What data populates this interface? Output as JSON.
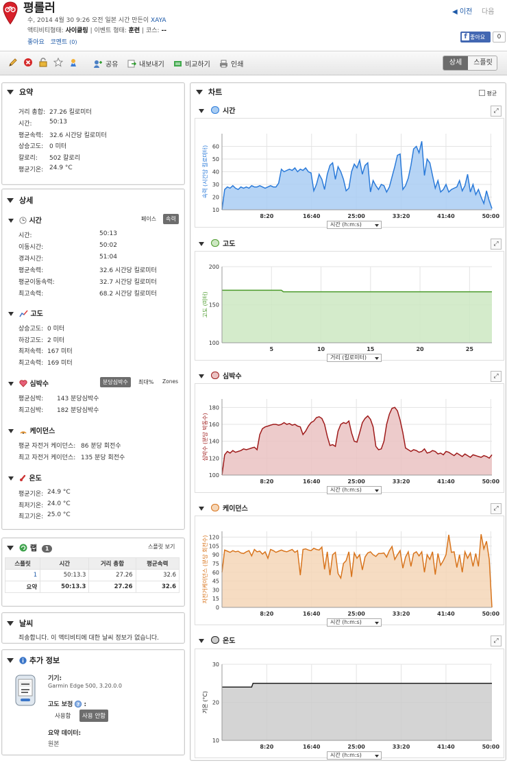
{
  "header": {
    "title": "평롤러",
    "meta_line": "수, 2014 4월 30 9:26 오전 일본 시간 만든이",
    "author": "XAYA",
    "activity_type_label": "액티비티형태:",
    "activity_type": "사이클링",
    "event_type_label": "| 이벤트 형태:",
    "event_type": "훈련",
    "course_label": "| 코스:",
    "course": "--",
    "like_link": "좋아요",
    "comment_link": "코멘트",
    "comment_count": "(0)",
    "prev": "◀ 이전",
    "next": "다음",
    "fb_like": "좋아요",
    "fb_count": "0"
  },
  "toolbar": {
    "share": "공유",
    "export": "내보내기",
    "compare": "비교하기",
    "print": "인쇄",
    "view_detail": "상세",
    "view_split": "스플릿"
  },
  "summary": {
    "title": "요약",
    "rows": [
      {
        "k": "거리 총합:",
        "v": "27.26 킬로미터"
      },
      {
        "k": "시간:",
        "v": "50:13"
      },
      {
        "k": "평균속력:",
        "v": "32.6 시간당 킬로미터"
      },
      {
        "k": "상승고도:",
        "v": "0 미터"
      },
      {
        "k": "칼로리:",
        "v": "502 칼로리"
      },
      {
        "k": "평균기온:",
        "v": "24.9 °C"
      }
    ]
  },
  "details": {
    "title": "상세",
    "time": {
      "title": "시간",
      "tab_pace": "페이스",
      "tab_speed": "속력",
      "rows": [
        {
          "k": "시간:",
          "v": "50:13"
        },
        {
          "k": "이동시간:",
          "v": "50:02"
        },
        {
          "k": "경과시간:",
          "v": "51:04"
        },
        {
          "k": "평균속력:",
          "v": "32.6 시간당 킬로미터"
        },
        {
          "k": "평균이동속력:",
          "v": "32.7 시간당 킬로미터"
        },
        {
          "k": "최고속력:",
          "v": "68.2 시간당 킬로미터"
        }
      ]
    },
    "elevation": {
      "title": "고도",
      "rows": [
        {
          "k": "상승고도:",
          "v": "0 미터"
        },
        {
          "k": "하강고도:",
          "v": "2 미터"
        },
        {
          "k": "최저속력:",
          "v": "167 미터"
        },
        {
          "k": "최고속력:",
          "v": "169 미터"
        }
      ]
    },
    "heart": {
      "title": "심박수",
      "tab_bpm": "분당심박수",
      "tab_max": "최대%",
      "tab_zones": "Zones",
      "rows": [
        {
          "k": "평균심박:",
          "v": "143 분당심박수"
        },
        {
          "k": "최고심박:",
          "v": "182 분당심박수"
        }
      ]
    },
    "cadence": {
      "title": "케이던스",
      "rows": [
        {
          "k": "평균 자전거 케이던스:",
          "v": "86 분당 회전수"
        },
        {
          "k": "최고 자전거 케이던스:",
          "v": "135 분당 회전수"
        }
      ]
    },
    "temp": {
      "title": "온도",
      "rows": [
        {
          "k": "평균기온:",
          "v": "24.9 °C"
        },
        {
          "k": "최저기온:",
          "v": "24.0 °C"
        },
        {
          "k": "최고기온:",
          "v": "25.0 °C"
        }
      ]
    }
  },
  "laps": {
    "title": "랩",
    "count": "1",
    "split_view": "스플릿 보기",
    "headers": [
      "스플릿",
      "시간",
      "거리 총합",
      "평균속력"
    ],
    "row": [
      "1",
      "50:13.3",
      "27.26",
      "32.6"
    ],
    "summary": [
      "요약",
      "50:13.3",
      "27.26",
      "32.6"
    ]
  },
  "weather": {
    "title": "날씨",
    "text": "죄송합니다. 이 액티비티에 대한 날씨 정보가 없습니다."
  },
  "extra": {
    "title": "추가 정보",
    "device_label": "기기:",
    "device": "Garmin Edge 500, 3.20.0.0",
    "elev_corr_label": "고도 보정",
    "elev_corr_suffix": ":",
    "use": "사용함",
    "not_use": "사용 안함",
    "summary_data_label": "요약 데이터:",
    "summary_data": "원본"
  },
  "charts_panel": {
    "title": "차트",
    "average_label": "평균",
    "expand_icon": "expand-icon",
    "time_axis_select": "시간 (h:m:s)",
    "dist_axis_select": "거리 (킬로미터)"
  },
  "colors": {
    "speed": "#2a7ad9",
    "elevation": "#4a9a2a",
    "heart": "#9e1a1a",
    "cadence": "#d8741c",
    "temp": "#222222"
  },
  "chart_data": [
    {
      "type": "area",
      "name_label": "시간",
      "ylabel": "속력 (시간당 킬로미터)",
      "ylim": [
        10,
        70
      ],
      "yticks": [
        "10",
        "20",
        "30",
        "40",
        "50",
        "60"
      ],
      "x_ticks": [
        "8:20",
        "16:40",
        "25:00",
        "33:20",
        "41:40",
        "50:00"
      ],
      "xlim_sec": [
        0,
        3013
      ],
      "series": [
        {
          "values": [
            10,
            26,
            28,
            27,
            29,
            27,
            26,
            28,
            27,
            28,
            27,
            29,
            28,
            28,
            29,
            28,
            27,
            28,
            29,
            28,
            28,
            31,
            42,
            40,
            41,
            42,
            41,
            43,
            40,
            42,
            41,
            43,
            40,
            39,
            25,
            30,
            38,
            34,
            26,
            38,
            45,
            47,
            34,
            44,
            40,
            34,
            25,
            27,
            40,
            46,
            43,
            49,
            38,
            45,
            47,
            24,
            33,
            29,
            26,
            30,
            29,
            24,
            28,
            36,
            44,
            53,
            54,
            26,
            29,
            35,
            45,
            58,
            60,
            55,
            64,
            37,
            50,
            47,
            37,
            27,
            33,
            24,
            26,
            30,
            24,
            26,
            27,
            28,
            33,
            25,
            29,
            38,
            24,
            30,
            22,
            26,
            20,
            15,
            25,
            17,
            11
          ]
        }
      ],
      "grid": true
    },
    {
      "type": "area",
      "name_label": "고도",
      "ylabel": "고도 (미터)",
      "ylim": [
        100,
        200
      ],
      "yticks": [
        "100",
        "150",
        "200"
      ],
      "x_ticks": [
        "5",
        "10",
        "15",
        "20",
        "25"
      ],
      "xlim_km": [
        0,
        27.26
      ],
      "series": [
        {
          "x": [
            0,
            6,
            6.2,
            27.26
          ],
          "values": [
            169,
            169,
            167,
            167
          ]
        }
      ],
      "grid": true
    },
    {
      "type": "area",
      "name_label": "심박수",
      "ylabel": "심박수 (분당 박동수)",
      "ylim": [
        100,
        190
      ],
      "yticks": [
        "100",
        "120",
        "140",
        "160",
        "180"
      ],
      "x_ticks": [
        "8:20",
        "16:40",
        "25:00",
        "33:20",
        "41:40",
        "50:00"
      ],
      "xlim_sec": [
        0,
        3013
      ],
      "series": [
        {
          "values": [
            100,
            124,
            128,
            126,
            129,
            127,
            128,
            129,
            131,
            130,
            131,
            132,
            133,
            130,
            148,
            155,
            157,
            158,
            159,
            160,
            160,
            159,
            160,
            162,
            160,
            161,
            159,
            160,
            158,
            157,
            148,
            152,
            158,
            162,
            164,
            168,
            169,
            167,
            160,
            146,
            135,
            136,
            134,
            152,
            160,
            162,
            161,
            164,
            150,
            140,
            139,
            150,
            162,
            167,
            170,
            166,
            157,
            134,
            130,
            131,
            140,
            160,
            172,
            179,
            180,
            176,
            165,
            150,
            132,
            130,
            128,
            130,
            129,
            127,
            128,
            131,
            126,
            127,
            129,
            128,
            125,
            126,
            124,
            128,
            127,
            125,
            123,
            126,
            124,
            122,
            125,
            123,
            121,
            124,
            123,
            122,
            121,
            123,
            122,
            120,
            124
          ]
        }
      ],
      "grid": true
    },
    {
      "type": "area",
      "name_label": "케이던스",
      "ylabel": "자전거케이던스 (분당 회전수)",
      "ylim": [
        0,
        130
      ],
      "yticks": [
        "0",
        "15",
        "30",
        "45",
        "60",
        "75",
        "90",
        "105",
        "120"
      ],
      "x_ticks": [
        "8:20",
        "16:40",
        "25:00",
        "33:20",
        "41:40",
        "50:00"
      ],
      "xlim_sec": [
        0,
        3013
      ],
      "series": [
        {
          "values": [
            60,
            98,
            96,
            94,
            97,
            95,
            96,
            93,
            92,
            95,
            97,
            88,
            99,
            95,
            96,
            91,
            95,
            84,
            99,
            97,
            94,
            96,
            98,
            96,
            95,
            97,
            99,
            94,
            97,
            55,
            99,
            100,
            98,
            97,
            101,
            99,
            98,
            103,
            65,
            95,
            55,
            90,
            94,
            58,
            50,
            75,
            80,
            95,
            52,
            93,
            84,
            90,
            64,
            86,
            93,
            95,
            90,
            87,
            92,
            92,
            93,
            86,
            97,
            104,
            82,
            90,
            97,
            67,
            86,
            95,
            70,
            92,
            95,
            88,
            95,
            60,
            90,
            82,
            95,
            56,
            92,
            72,
            80,
            90,
            124,
            94,
            95,
            68,
            90,
            60,
            95,
            84,
            93,
            70,
            92,
            70,
            125,
            100,
            113,
            82,
            0
          ]
        }
      ],
      "grid": true
    },
    {
      "type": "area",
      "name_label": "온도",
      "ylabel": "기온 (°C)",
      "ylim": [
        10,
        30
      ],
      "yticks": [
        "10",
        "20",
        "30"
      ],
      "x_ticks": [
        "8:20",
        "16:40",
        "25:00",
        "33:20",
        "41:40",
        "50:00"
      ],
      "xlim_sec": [
        0,
        3013
      ],
      "series": [
        {
          "x_frac": [
            0,
            0.11,
            0.115,
            1
          ],
          "values": [
            24,
            24,
            25,
            25
          ]
        }
      ],
      "grid": true
    }
  ]
}
